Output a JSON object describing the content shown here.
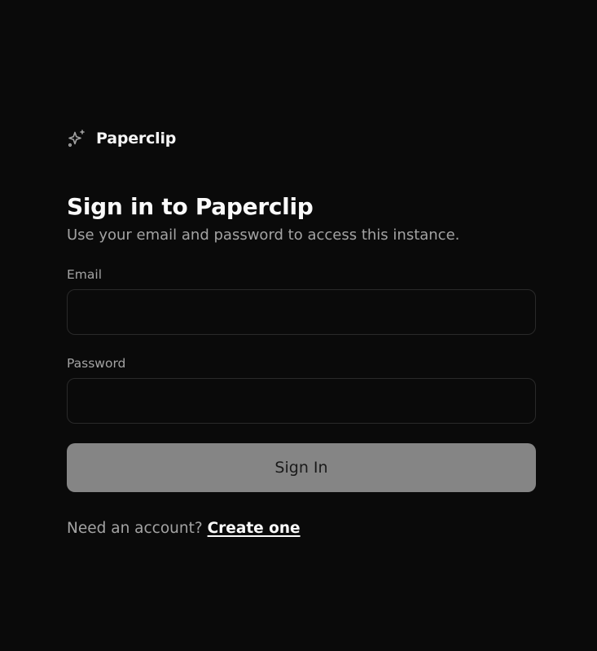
{
  "brand": {
    "icon": "sparkles-icon",
    "name": "Paperclip"
  },
  "auth": {
    "title": "Sign in to Paperclip",
    "subtitle": "Use your email and password to access this instance.",
    "email_label": "Email",
    "email_value": "",
    "password_label": "Password",
    "password_value": "",
    "submit_label": "Sign In",
    "footer_prompt": "Need an account?",
    "footer_link": "Create one"
  },
  "colors": {
    "background": "#0a0a0a",
    "button_disabled": "#858585",
    "input_border": "#2a2a2a",
    "text_primary": "#fafafa",
    "text_muted": "#a3a3a3"
  }
}
